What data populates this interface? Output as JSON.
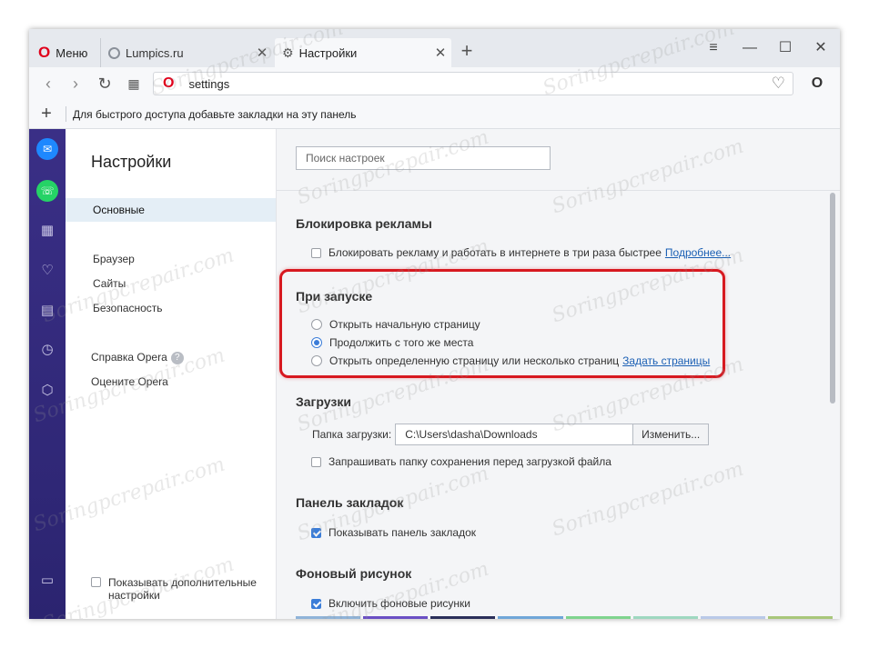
{
  "tabs": {
    "menu_label": "Меню",
    "lumpics_label": "Lumpics.ru",
    "settings_label": "Настройки",
    "close_glyph": "✕",
    "new_tab_glyph": "+"
  },
  "address": {
    "url": "settings"
  },
  "bookmarks_bar": {
    "hint": "Для быстрого доступа добавьте закладки на эту панель"
  },
  "nav": {
    "title": "Настройки",
    "items": [
      {
        "label": "Основные",
        "selected": true
      },
      {
        "label": "Браузер"
      },
      {
        "label": "Сайты"
      },
      {
        "label": "Безопасность"
      }
    ],
    "help": "Справка Opera",
    "rate": "Оцените Opera",
    "advanced": "Показывать дополнительные настройки"
  },
  "search": {
    "placeholder": "Поиск настроек"
  },
  "adblock": {
    "title": "Блокировка рекламы",
    "checkbox": "Блокировать рекламу и работать в интернете в три раза быстрее",
    "link": "Подробнее..."
  },
  "startup": {
    "title": "При запуске",
    "options": [
      "Открыть начальную страницу",
      "Продолжить с того же места",
      "Открыть определенную страницу или несколько страниц"
    ],
    "selected_index": 1,
    "link": "Задать страницы"
  },
  "downloads": {
    "title": "Загрузки",
    "folder_label": "Папка загрузки:",
    "folder_value": "C:\\Users\\dasha\\Downloads",
    "change_button": "Изменить...",
    "ask_checkbox": "Запрашивать папку сохранения перед загрузкой файла"
  },
  "bookmarks_panel": {
    "title": "Панель закладок",
    "checkbox": "Показывать панель закладок"
  },
  "wallpaper": {
    "title": "Фоновый рисунок",
    "checkbox": "Включить фоновые рисунки",
    "thumb_colors": [
      "#8fb4d9",
      "#6a4fc4",
      "#2a2f5a",
      "#6fa6d8",
      "#7fd48e",
      "#9ed8c0",
      "#b9c9e8",
      "#a8c77a"
    ]
  },
  "colors": {
    "accent": "#3b7dd8",
    "highlight": "#d71920",
    "sidebar": "#2b2470"
  }
}
